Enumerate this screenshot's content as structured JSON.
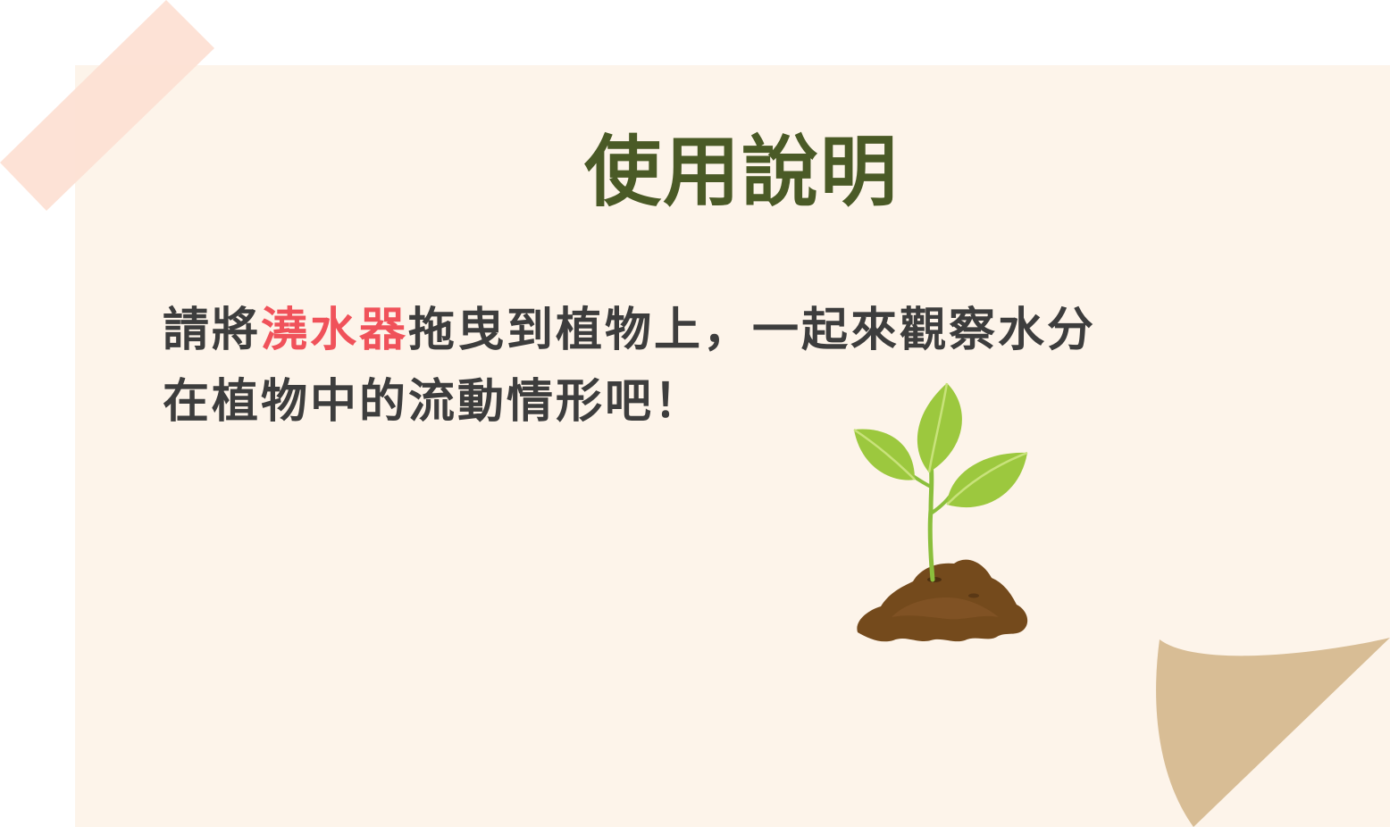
{
  "title": "使用說明",
  "instructions": {
    "part1": "請將",
    "highlight": "澆水器",
    "part2": "拖曳到植物上，一起來觀察水分",
    "line2": "在植物中的流動情形吧！"
  },
  "colors": {
    "title": "#4a5a26",
    "text": "#3d3d3d",
    "highlight": "#f0525a",
    "note_background": "#fdf4ea",
    "tape": "#fde0d2",
    "page_curl": "#d8bd95"
  },
  "icons": {
    "plant": "seedling-in-soil-illustration",
    "tape": "masking-tape",
    "curl": "page-curl"
  }
}
